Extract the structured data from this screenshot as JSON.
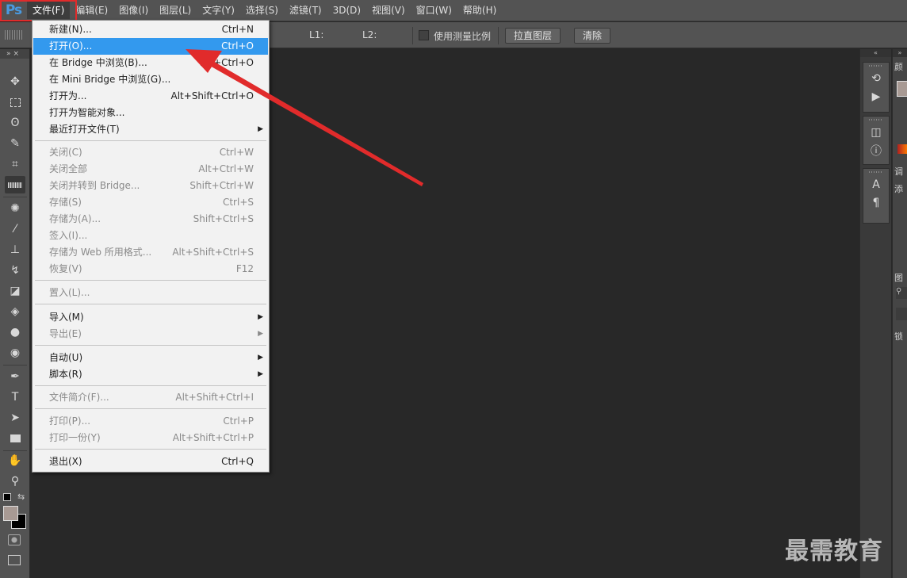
{
  "app": {
    "logo": "Ps"
  },
  "menubar": {
    "items": [
      "文件(F)",
      "编辑(E)",
      "图像(I)",
      "图层(L)",
      "文字(Y)",
      "选择(S)",
      "滤镜(T)",
      "3D(D)",
      "视图(V)",
      "窗口(W)",
      "帮助(H)"
    ],
    "active_index": 0
  },
  "options": {
    "l1_label": "L1:",
    "l2_label": "L2:",
    "scale_checkbox_label": "使用测量比例",
    "straighten_button": "拉直图层",
    "clear_button": "清除"
  },
  "file_menu": {
    "items": [
      {
        "label": "新建(N)...",
        "shortcut": "Ctrl+N",
        "enabled": true
      },
      {
        "label": "打开(O)...",
        "shortcut": "Ctrl+O",
        "enabled": true,
        "highlighted": true
      },
      {
        "label": "在 Bridge 中浏览(B)...",
        "shortcut": "Alt+Ctrl+O",
        "enabled": true
      },
      {
        "label": "在 Mini Bridge 中浏览(G)...",
        "shortcut": "",
        "enabled": true
      },
      {
        "label": "打开为...",
        "shortcut": "Alt+Shift+Ctrl+O",
        "enabled": true
      },
      {
        "label": "打开为智能对象...",
        "shortcut": "",
        "enabled": true
      },
      {
        "label": "最近打开文件(T)",
        "shortcut": "",
        "enabled": true,
        "submenu": true
      },
      {
        "label": "关闭(C)",
        "shortcut": "Ctrl+W",
        "enabled": false
      },
      {
        "label": "关闭全部",
        "shortcut": "Alt+Ctrl+W",
        "enabled": false
      },
      {
        "label": "关闭并转到 Bridge...",
        "shortcut": "Shift+Ctrl+W",
        "enabled": false
      },
      {
        "label": "存储(S)",
        "shortcut": "Ctrl+S",
        "enabled": false
      },
      {
        "label": "存储为(A)...",
        "shortcut": "Shift+Ctrl+S",
        "enabled": false
      },
      {
        "label": "签入(I)...",
        "shortcut": "",
        "enabled": false
      },
      {
        "label": "存储为 Web 所用格式...",
        "shortcut": "Alt+Shift+Ctrl+S",
        "enabled": false
      },
      {
        "label": "恢复(V)",
        "shortcut": "F12",
        "enabled": false
      },
      {
        "label": "置入(L)...",
        "shortcut": "",
        "enabled": false
      },
      {
        "label": "导入(M)",
        "shortcut": "",
        "enabled": true,
        "submenu": true
      },
      {
        "label": "导出(E)",
        "shortcut": "",
        "enabled": false,
        "submenu": true
      },
      {
        "label": "自动(U)",
        "shortcut": "",
        "enabled": true,
        "submenu": true
      },
      {
        "label": "脚本(R)",
        "shortcut": "",
        "enabled": true,
        "submenu": true
      },
      {
        "label": "文件简介(F)...",
        "shortcut": "Alt+Shift+Ctrl+I",
        "enabled": false
      },
      {
        "label": "打印(P)...",
        "shortcut": "Ctrl+P",
        "enabled": false
      },
      {
        "label": "打印一份(Y)",
        "shortcut": "Alt+Shift+Ctrl+P",
        "enabled": false
      },
      {
        "label": "退出(X)",
        "shortcut": "Ctrl+Q",
        "enabled": true
      }
    ]
  },
  "toolbar": {
    "tools": [
      "move-tool-icon",
      "marquee-tool-icon",
      "lasso-tool-icon",
      "quick-select-tool-icon",
      "crop-tool-icon",
      "ruler-tool-icon",
      "spot-heal-tool-icon",
      "brush-tool-icon",
      "clone-stamp-tool-icon",
      "history-brush-tool-icon",
      "eraser-tool-icon",
      "paint-bucket-tool-icon",
      "blur-tool-icon",
      "dodge-tool-icon",
      "pen-tool-icon",
      "type-tool-icon",
      "path-select-tool-icon",
      "rectangle-tool-icon",
      "hand-tool-icon",
      "zoom-tool-icon"
    ],
    "active_tool": "ruler-tool-icon"
  },
  "right_panels": {
    "tab_labels": [
      "颜",
      "调",
      "添",
      "图",
      "锁"
    ]
  },
  "watermark": "最需教育",
  "colors": {
    "accent_highlight": "#3399ee",
    "annotation_red": "#e12b2b",
    "ps_blue": "#4a9ae0",
    "foreground_swatch": "#a89a94",
    "background_swatch": "#000000"
  }
}
